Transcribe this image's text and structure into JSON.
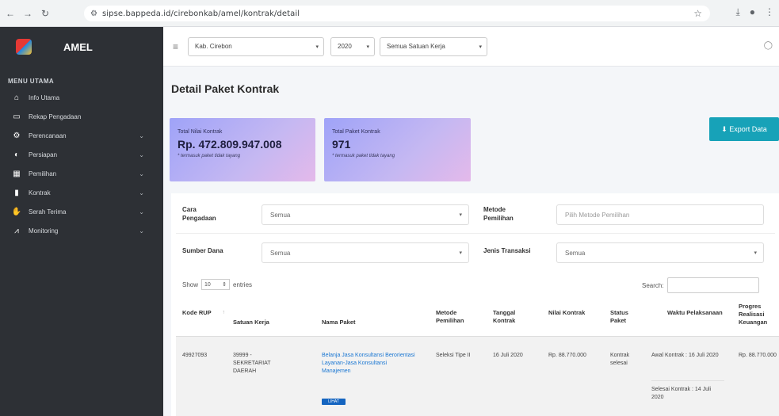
{
  "browser": {
    "url": "sipse.bappeda.id/cirebonkab/amel/kontrak/detail"
  },
  "sidebar": {
    "brand": "AMEL",
    "menu_title": "MENU UTAMA",
    "items": [
      {
        "label": "Info Utama",
        "icon": "home-icon",
        "chevron": false
      },
      {
        "label": "Rekap Pengadaan",
        "icon": "monitor-icon",
        "chevron": false
      },
      {
        "label": "Perencanaan",
        "icon": "gear-icon",
        "chevron": true
      },
      {
        "label": "Persiapan",
        "icon": "half-circle-icon",
        "chevron": true
      },
      {
        "label": "Pemilihan",
        "icon": "calendar-icon",
        "chevron": true
      },
      {
        "label": "Kontrak",
        "icon": "document-icon",
        "chevron": true
      },
      {
        "label": "Serah Terima",
        "icon": "handshake-icon",
        "chevron": true
      },
      {
        "label": "Monitoring",
        "icon": "chart-line-icon",
        "chevron": true
      }
    ]
  },
  "topbar": {
    "kabupaten": "Kab. Cirebon",
    "year": "2020",
    "satuan_kerja": "Semua Satuan Kerja"
  },
  "page": {
    "title": "Detail Paket Kontrak",
    "export_label": "⬇ Export Data"
  },
  "cards": [
    {
      "label": "Total Nilai Kontrak",
      "value": "Rp. 472.809.947.008",
      "note": "* termasuk paket tidak tayang"
    },
    {
      "label": "Total Paket Kontrak",
      "value": "971",
      "note": "* termasuk paket tidak tayang"
    }
  ],
  "filters": {
    "cara_pengadaan_label": "Cara Pengadaan",
    "cara_pengadaan_value": "Semua",
    "metode_pemilihan_label": "Metode Pemilihan",
    "metode_pemilihan_placeholder": "Pilih Metode Pemilihan",
    "sumber_dana_label": "Sumber Dana",
    "sumber_dana_value": "Semua",
    "jenis_transaksi_label": "Jenis Transaksi",
    "jenis_transaksi_value": "Semua"
  },
  "table": {
    "show_label": "Show",
    "show_value": "10",
    "entries_label": "entries",
    "search_label": "Search:",
    "headers": [
      "Kode RUP",
      "Satuan Kerja",
      "Nama Paket",
      "Metode Pemilihan",
      "Tanggal Kontrak",
      "Nilai Kontrak",
      "Status Paket",
      "Waktu Pelaksanaan",
      "Progres Realisasi Keuangan"
    ],
    "row": {
      "kode_rup": "49927093",
      "satuan_kerja": "39999 - SEKRETARIAT DAERAH",
      "nama_paket": "Belanja Jasa Konsultansi Berorientasi Layanan-Jasa Konsultansi Manajemen",
      "badge": "LIHAT",
      "metode": "Seleksi Tipe II",
      "tanggal": "16 Juli 2020",
      "nilai": "Rp. 88.770.000",
      "status": "Kontrak selesai",
      "waktu_mulai": "Awal Kontrak : 16 Juli 2020",
      "waktu_selesai": "Selesai Kontrak : 14 Juli 2020",
      "progres": "Rp. 88.770.000"
    }
  },
  "colors": {
    "sidebar": "#2d3035",
    "export": "#17a2b8",
    "link": "#1976d2"
  }
}
